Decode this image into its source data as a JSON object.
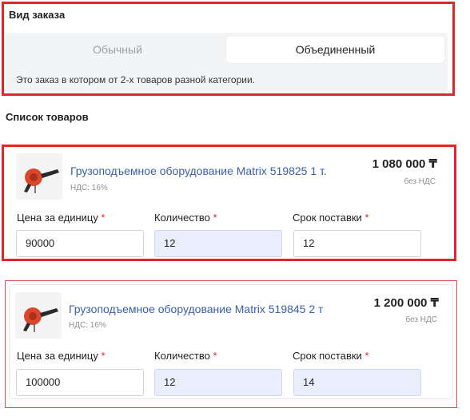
{
  "order_type": {
    "title": "Вид заказа",
    "options": [
      "Обычный",
      "Объединенный"
    ],
    "selected": "Объединенный",
    "description": "Это заказ в котором от 2-х товаров разной категории."
  },
  "products_list": {
    "title": "Список товаров",
    "items": [
      {
        "name": "Грузоподъемное оборудование Matrix 519825 1 т.",
        "vat": "НДС: 16%",
        "price": "1 080 000 ₸",
        "price_note": "без НДС",
        "labels": {
          "unit_price": "Цена за единицу",
          "quantity": "Количество",
          "delivery": "Срок поставки"
        },
        "unit_price": "90000",
        "quantity": "12",
        "delivery": "12"
      },
      {
        "name": "Грузоподъемное оборудование Matrix 519845 2 т",
        "vat": "НДС: 16%",
        "price": "1 200 000 ₸",
        "price_note": "без НДС",
        "labels": {
          "unit_price": "Цена за единицу",
          "quantity": "Количество",
          "delivery": "Срок поставки"
        },
        "unit_price": "100000",
        "quantity": "12",
        "delivery": "14"
      }
    ]
  },
  "colors": {
    "highlight": "#e0262b",
    "link": "#3a5fa8",
    "readonly_field": "#e8eefb"
  },
  "icons": {
    "product_thumb": "hoist-icon",
    "required": "asterisk-icon"
  }
}
